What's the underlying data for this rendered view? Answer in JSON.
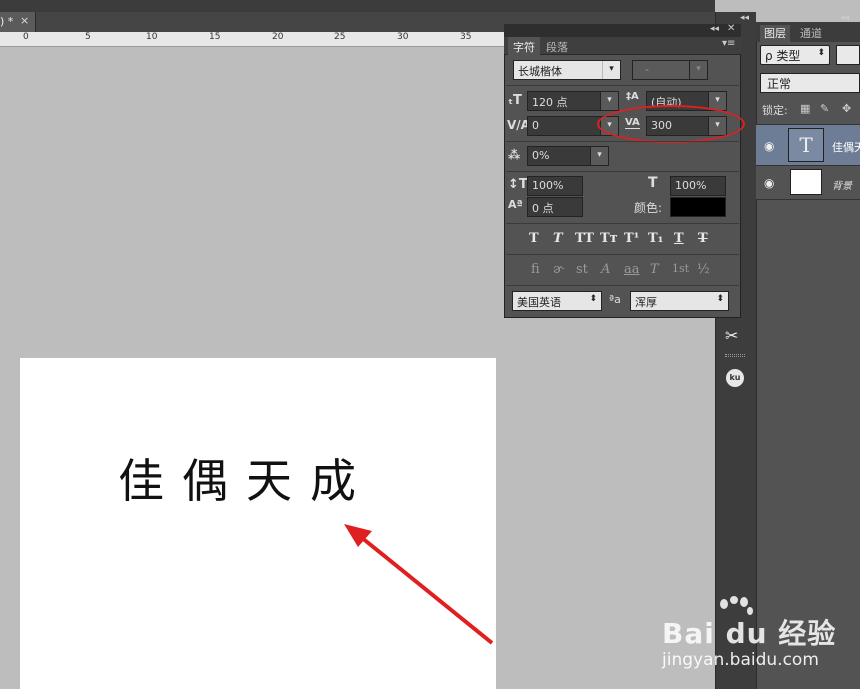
{
  "document_tab": {
    "label": ") *",
    "close": "×"
  },
  "ruler": {
    "ticks": [
      "0",
      "5",
      "10",
      "15",
      "20",
      "25",
      "30",
      "35"
    ]
  },
  "canvas": {
    "text": "佳偶天成"
  },
  "character_panel": {
    "tabs": [
      "字符",
      "段落"
    ],
    "font_family": "长城楷体",
    "font_style": "-",
    "font_size": "120 点",
    "leading": "(自动)",
    "kerning": "0",
    "tracking": "300",
    "tsume": "0%",
    "vertical_scale": "100%",
    "horizontal_scale": "100%",
    "baseline_shift": "0 点",
    "color_label": "颜色:",
    "text_color": "#000000",
    "format_buttons": [
      "T",
      "T",
      "TT",
      "Tт",
      "T¹",
      "T₁",
      "T",
      "T"
    ],
    "opentype_buttons": [
      "fi",
      "ɚ",
      "st",
      "A",
      "aa",
      "T",
      "1st",
      "½"
    ],
    "language": "美国英语",
    "aa_icon": "ªa",
    "anti_alias": "浑厚"
  },
  "layers_panel": {
    "tabs": [
      "图层",
      "通道"
    ],
    "filter": "ρ 类型",
    "blend_mode": "正常",
    "lock_label": "锁定:",
    "layers": [
      {
        "name": "佳偶天",
        "type": "text"
      },
      {
        "name": "背景",
        "type": "background"
      }
    ]
  },
  "watermark": {
    "logo": "Bai du 经验",
    "url": "jingyan.baidu.com"
  },
  "colors": {
    "annotation_red": "#e02020",
    "panel_bg": "#535353",
    "selected_layer": "#6d7d95"
  }
}
